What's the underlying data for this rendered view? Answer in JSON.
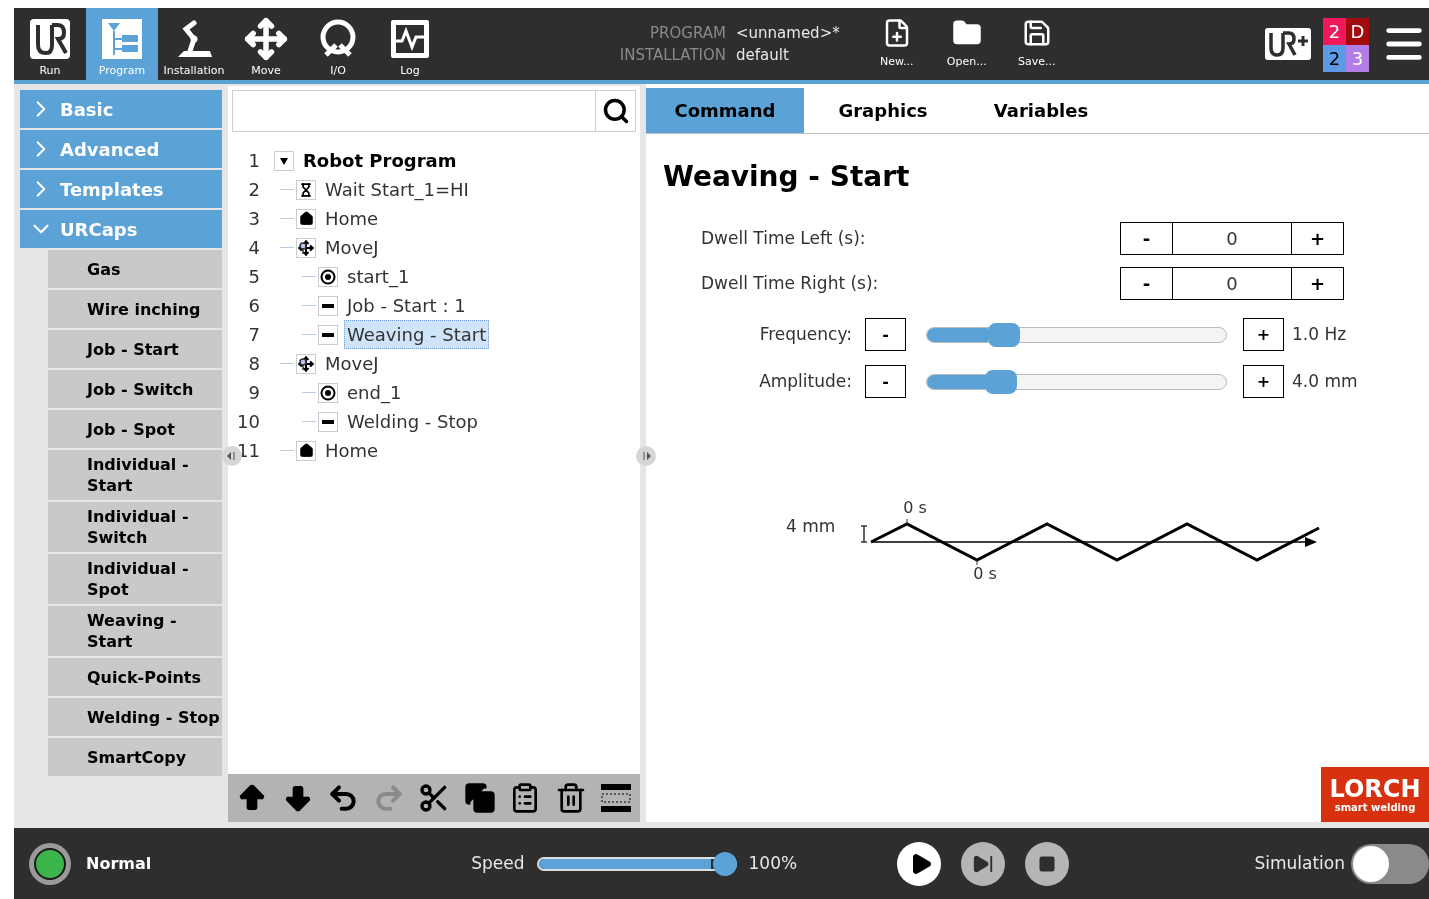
{
  "header": {
    "nav": [
      {
        "label": "Run",
        "kind": "run",
        "selected": false
      },
      {
        "label": "Program",
        "kind": "program",
        "selected": true
      },
      {
        "label": "Installation",
        "kind": "installation",
        "selected": false
      },
      {
        "label": "Move",
        "kind": "move",
        "selected": false
      },
      {
        "label": "I/O",
        "kind": "io",
        "selected": false
      },
      {
        "label": "Log",
        "kind": "log",
        "selected": false
      }
    ],
    "program_label": "PROGRAM",
    "program_value": "<unnamed>*",
    "installation_label": "INSTALLATION",
    "installation_value": "default",
    "file_buttons": [
      {
        "label": "New...",
        "kind": "new"
      },
      {
        "label": "Open...",
        "kind": "open"
      },
      {
        "label": "Save...",
        "kind": "save"
      }
    ],
    "badge_cells": [
      {
        "text": "2",
        "color": "#f2195a"
      },
      {
        "text": "D",
        "color": "#a30c0c"
      },
      {
        "text": "2",
        "color": "#5d9ae6"
      },
      {
        "text": "3",
        "color": "#b37de6"
      }
    ]
  },
  "sidebar": {
    "categories": [
      {
        "label": "Basic",
        "expanded": false
      },
      {
        "label": "Advanced",
        "expanded": false
      },
      {
        "label": "Templates",
        "expanded": false
      },
      {
        "label": "URCaps",
        "expanded": true,
        "items": [
          "Gas",
          "Wire inching",
          "Job - Start",
          "Job - Switch",
          "Job - Spot",
          "Individual - Start",
          "Individual - Switch",
          "Individual - Spot",
          "Weaving - Start",
          "Quick-Points",
          "Welding - Stop",
          "SmartCopy"
        ]
      }
    ]
  },
  "tree": {
    "nodes": [
      {
        "line": "1",
        "label": "Robot Program",
        "kind": "root",
        "expanded": true,
        "selected": false,
        "children": [
          {
            "line": "2",
            "label": "Wait Start_1=HI",
            "kind": "wait",
            "selected": false
          },
          {
            "line": "3",
            "label": "Home",
            "kind": "home",
            "selected": false
          },
          {
            "line": "4",
            "label": "MoveJ",
            "kind": "move",
            "selected": false,
            "children": [
              {
                "line": "5",
                "label": "start_1",
                "kind": "waypoint",
                "selected": false
              },
              {
                "line": "6",
                "label": "Job - Start : 1",
                "kind": "urcap",
                "selected": false
              },
              {
                "line": "7",
                "label": "Weaving - Start",
                "kind": "urcap",
                "selected": true
              }
            ]
          },
          {
            "line": "8",
            "label": "MoveJ",
            "kind": "move",
            "selected": false,
            "children": [
              {
                "line": "9",
                "label": "end_1",
                "kind": "waypoint",
                "selected": false
              },
              {
                "line": "10",
                "label": "Welding - Stop",
                "kind": "urcap",
                "selected": false
              }
            ]
          },
          {
            "line": "11",
            "label": "Home",
            "kind": "home",
            "selected": false
          }
        ]
      }
    ]
  },
  "toolbar": [
    {
      "kind": "up",
      "disabled": false
    },
    {
      "kind": "down",
      "disabled": false
    },
    {
      "kind": "undo",
      "disabled": false
    },
    {
      "kind": "redo",
      "disabled": true
    },
    {
      "kind": "cut",
      "disabled": false
    },
    {
      "kind": "copy",
      "disabled": false
    },
    {
      "kind": "paste",
      "disabled": false
    },
    {
      "kind": "delete",
      "disabled": false
    },
    {
      "kind": "suppress",
      "disabled": false
    }
  ],
  "tabs": [
    {
      "label": "Command",
      "selected": true
    },
    {
      "label": "Graphics",
      "selected": false
    },
    {
      "label": "Variables",
      "selected": false
    }
  ],
  "command": {
    "title": "Weaving - Start",
    "dwell": [
      {
        "label": "Dwell Time Left (s):",
        "minus": "-",
        "value": "0",
        "plus": "+"
      },
      {
        "label": "Dwell Time Right (s):",
        "minus": "-",
        "value": "0",
        "plus": "+"
      }
    ],
    "sliders": [
      {
        "label": "Frequency:",
        "minus": "-",
        "level": 0.23,
        "plus": "+",
        "reading": "1.0 Hz"
      },
      {
        "label": "Amplitude:",
        "minus": "-",
        "level": 0.22,
        "plus": "+",
        "reading": "4.0 mm"
      }
    ],
    "diagram": {
      "amplitude_label": "4 mm",
      "top_time": "0 s",
      "bottom_time": "0 s"
    },
    "brand": {
      "name": "LORCH",
      "tagline": "smart welding"
    }
  },
  "footer": {
    "status": "Normal",
    "speed_label": "Speed",
    "speed": {
      "level": 1.0
    },
    "speed_reading": "100%",
    "simulation_label": "Simulation",
    "simulation_on": false
  }
}
